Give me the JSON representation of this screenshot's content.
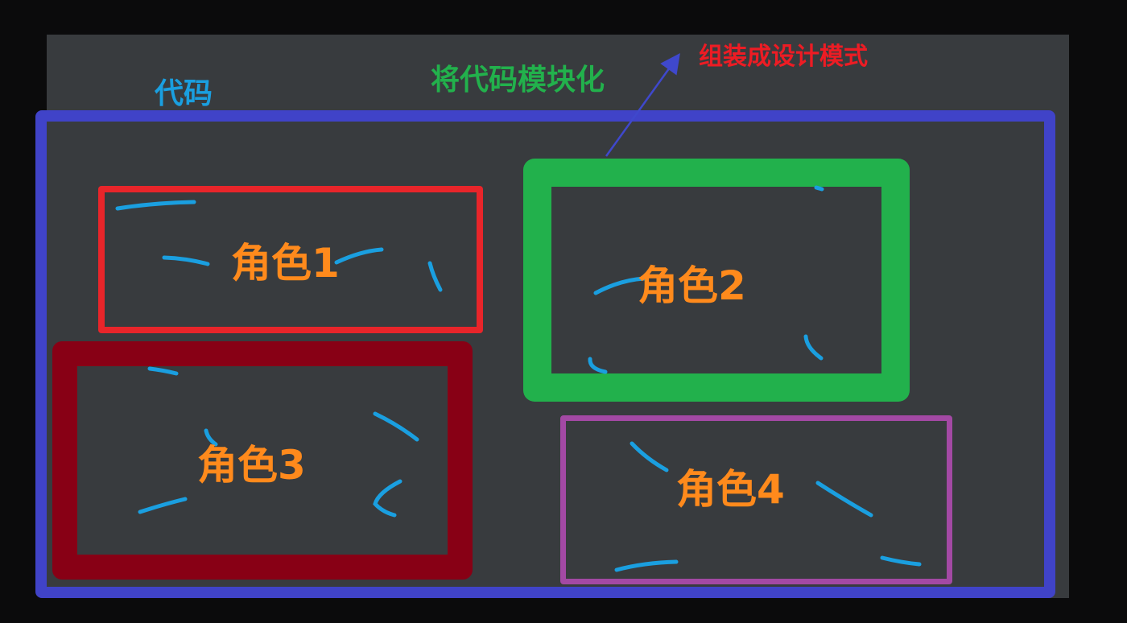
{
  "labels": {
    "code": "代码",
    "modularize": "将代码模块化",
    "assemble_pattern": "组装成设计模式"
  },
  "roles": [
    "角色1",
    "角色2",
    "角色3",
    "角色4"
  ],
  "colors": {
    "background": "#0b0b0c",
    "canvas": "#383b3e",
    "outer_box": "#4043c8",
    "role1_box": "#e8252a",
    "role2_box": "#22b14c",
    "role3_box": "#880015",
    "role4_box": "#a349a4",
    "role_text": "#ff8a1c",
    "code_text": "#1a9fe0",
    "modularize_text": "#22b14c",
    "pattern_text": "#ed1c24",
    "arrow": "#3f48cc",
    "strokes": "#1a9fe0"
  },
  "icons": {
    "arrow": "arrow-up-right-icon",
    "scribble": "code-stroke-icon"
  }
}
